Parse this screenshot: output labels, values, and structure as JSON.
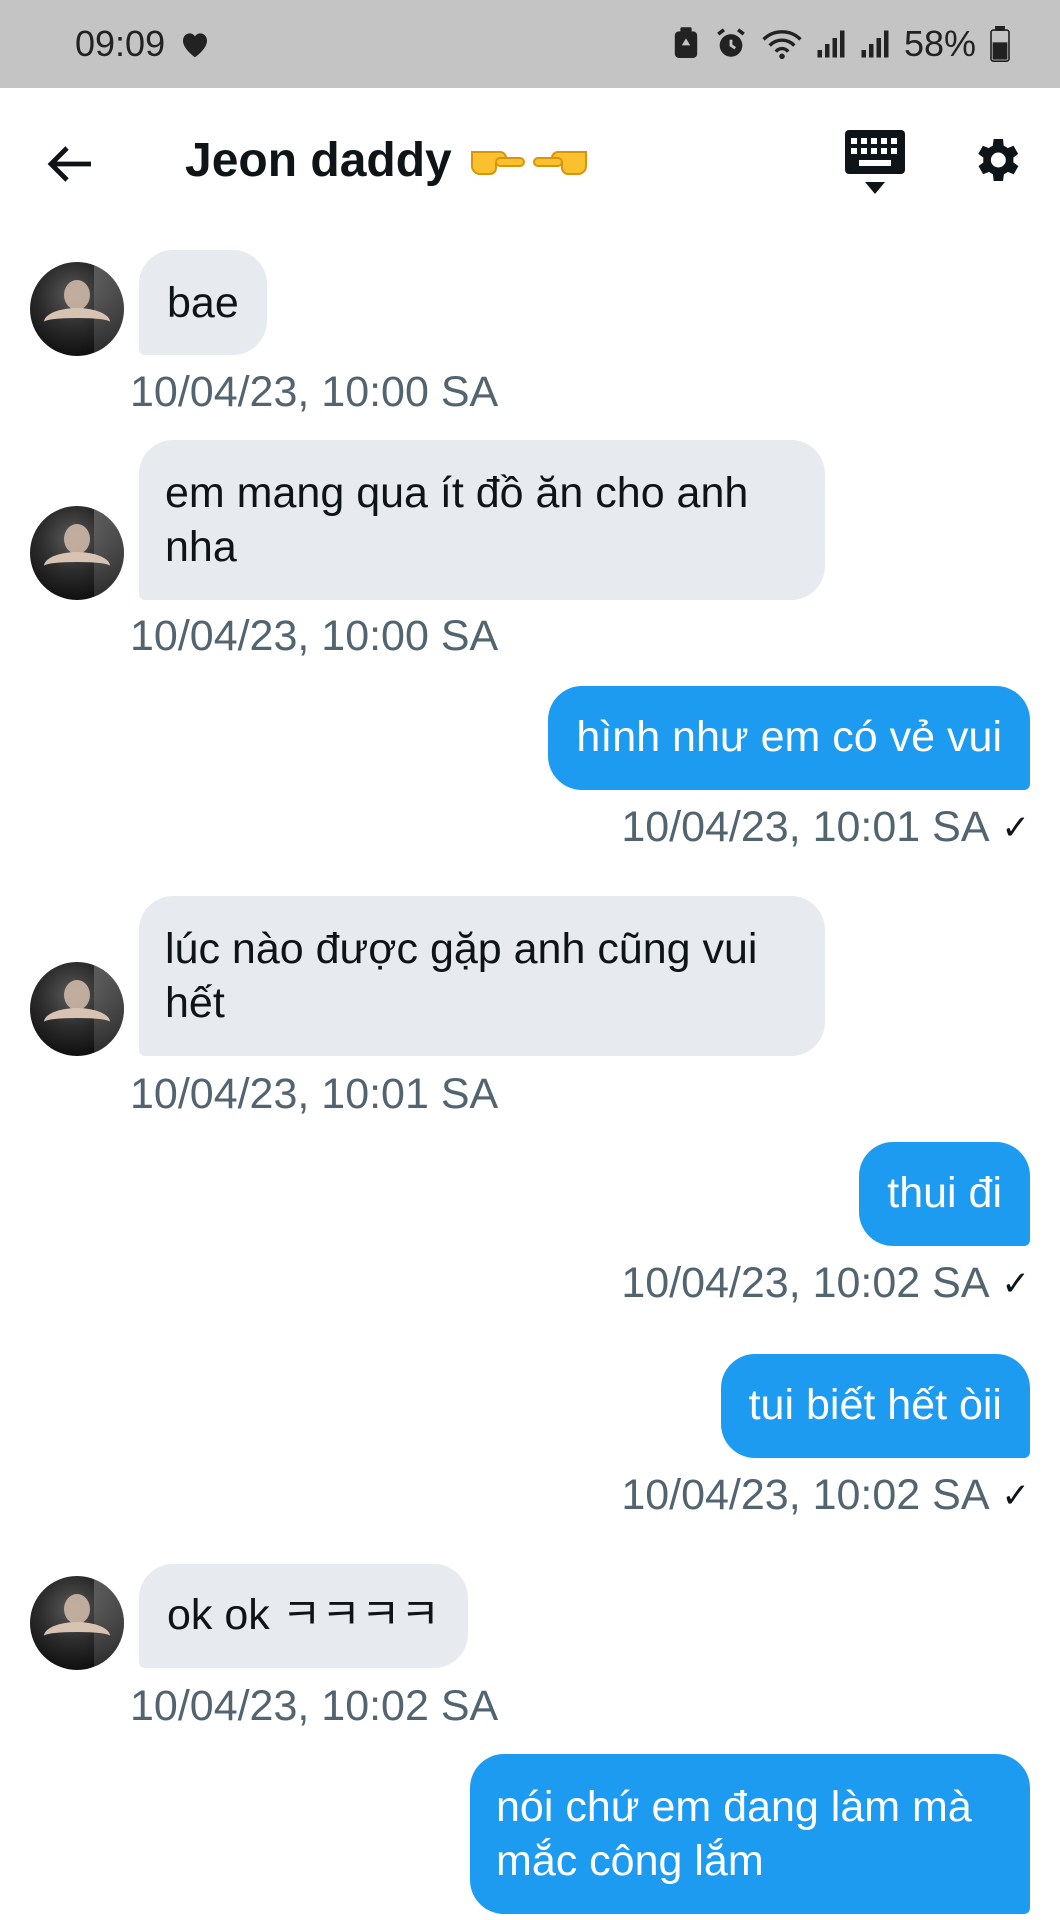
{
  "status_bar": {
    "time": "09:09",
    "battery": "58%"
  },
  "header": {
    "title": "Jeon daddy"
  },
  "messages": [
    {
      "dir": "in",
      "text": "bae",
      "time": "10/04/23, 10:00 SA"
    },
    {
      "dir": "in",
      "text": "em mang qua ít đồ ăn cho anh nha",
      "time": "10/04/23, 10:00 SA"
    },
    {
      "dir": "out",
      "text": "hình như em có vẻ vui",
      "time": "10/04/23, 10:01 SA",
      "read": "✓"
    },
    {
      "dir": "in",
      "text": "lúc nào được gặp anh cũng vui hết",
      "time": "10/04/23, 10:01 SA"
    },
    {
      "dir": "out",
      "text": "thui đi",
      "time": "10/04/23, 10:02 SA",
      "read": "✓"
    },
    {
      "dir": "out",
      "text": "tui biết hết òii",
      "time": "10/04/23, 10:02 SA",
      "read": "✓"
    },
    {
      "dir": "in",
      "text": "ok ok ㅋㅋㅋㅋ",
      "time": "10/04/23, 10:02 SA"
    },
    {
      "dir": "out",
      "text": "nói chứ em đang làm mà mắc công lắm",
      "time": ""
    }
  ],
  "icons": {
    "back": "arrow-left-icon",
    "keyboard": "keyboard-icon",
    "settings": "gear-icon",
    "title_emoji": "pointing-hands-emoji"
  },
  "colors": {
    "outgoing_bubble": "#1d9bf0",
    "incoming_bubble": "#e7eaee",
    "timestamp": "#536471",
    "status_bar": "#c4c4c4"
  }
}
